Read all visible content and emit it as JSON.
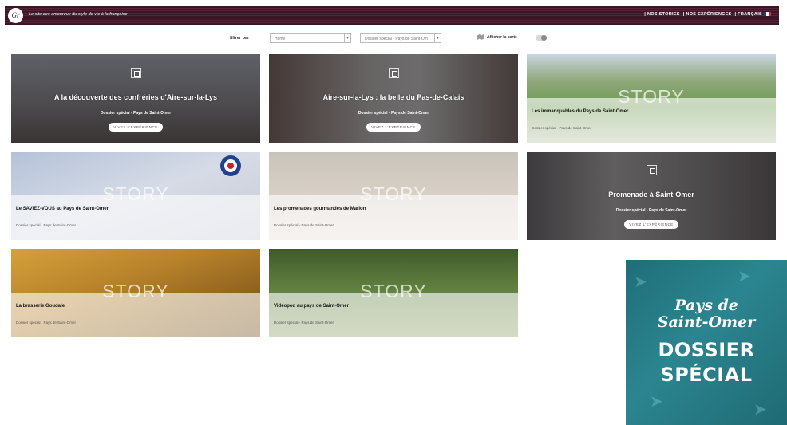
{
  "header": {
    "logo_text": "Gr",
    "tagline": "Le site des amoureux du style de vie à la française",
    "nav": [
      "| NOS STORIES",
      "| NOS EXPÉRIENCES",
      "| FRANÇAIS"
    ]
  },
  "filters": {
    "label": "filtrer par",
    "select1": "Home",
    "select2": "Dossier spécial - Pays de Saint-Om",
    "map_label": "Afficher la carte"
  },
  "cards": [
    {
      "title": "A la découverte des confréries d'Aire-sur-la-Lys",
      "subtitle": "Dossier spécial - Pays de Saint-Omer",
      "button": "VIVEZ L'EXPÉRIENCE"
    },
    {
      "title": "Aire-sur-la-Lys : la belle du Pas-de-Calais",
      "subtitle": "Dossier spécial - Pays de Saint-Omer",
      "button": "VIVEZ L'EXPÉRIENCE"
    },
    {
      "title": "Les immanquables du Pays de Saint-Omer",
      "subtitle": "Dossier spécial - Pays de Saint-Omer",
      "story": "STORY"
    },
    {
      "title": "Le SAVIEZ-VOUS au Pays de Saint-Omer",
      "subtitle": "Dossier spécial - Pays de Saint-Omer",
      "story": "STORY"
    },
    {
      "title": "Les promenades gourmandes de Marion",
      "subtitle": "Dossier spécial - Pays de Saint-Omer",
      "story": "STORY"
    },
    {
      "title": "Promenade à Saint-Omer",
      "subtitle": "Dossier spécial - Pays de Saint-Omer",
      "button": "VIVEZ L'EXPÉRIENCE"
    },
    {
      "title": "La brasserie Goudale",
      "subtitle": "Dossier spécial - Pays de Saint-Omer",
      "story": "STORY"
    },
    {
      "title": "Vidéopod au pays de Saint-Omer",
      "subtitle": "Dossier spécial - Pays de Saint-Omer",
      "story": "STORY"
    }
  ],
  "promo": {
    "line1": "Pays de",
    "line2": "Saint-Omer",
    "line3": "DOSSIER",
    "line4": "SPÉCIAL"
  },
  "colors": {
    "header": "#3d1626",
    "promo": "#2b8590"
  }
}
